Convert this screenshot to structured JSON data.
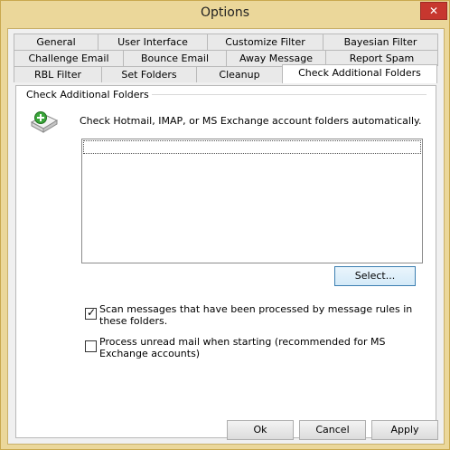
{
  "window": {
    "title": "Options",
    "close_glyph": "✕"
  },
  "tabs": {
    "row1": [
      "General",
      "User Interface",
      "Customize Filter",
      "Bayesian Filter"
    ],
    "row2": [
      "Challenge Email",
      "Bounce Email",
      "Away Message",
      "Report Spam"
    ],
    "row3": [
      "RBL Filter",
      "Set Folders",
      "Cleanup",
      "Check Additional Folders"
    ],
    "active": "Check Additional Folders"
  },
  "panel": {
    "group_title": "Check Additional Folders",
    "description": "Check Hotmail, IMAP, or MS Exchange account folders automatically.",
    "folder_list": [],
    "select_button": "Select...",
    "options": [
      {
        "label": "Scan messages that have been processed by message rules in these folders.",
        "checked": true
      },
      {
        "label": "Process unread mail when starting (recommended for MS Exchange accounts)",
        "checked": false
      }
    ]
  },
  "footer": {
    "ok": "Ok",
    "cancel": "Cancel",
    "apply": "Apply"
  },
  "icons": {
    "folder_add": "folder-add-icon"
  }
}
